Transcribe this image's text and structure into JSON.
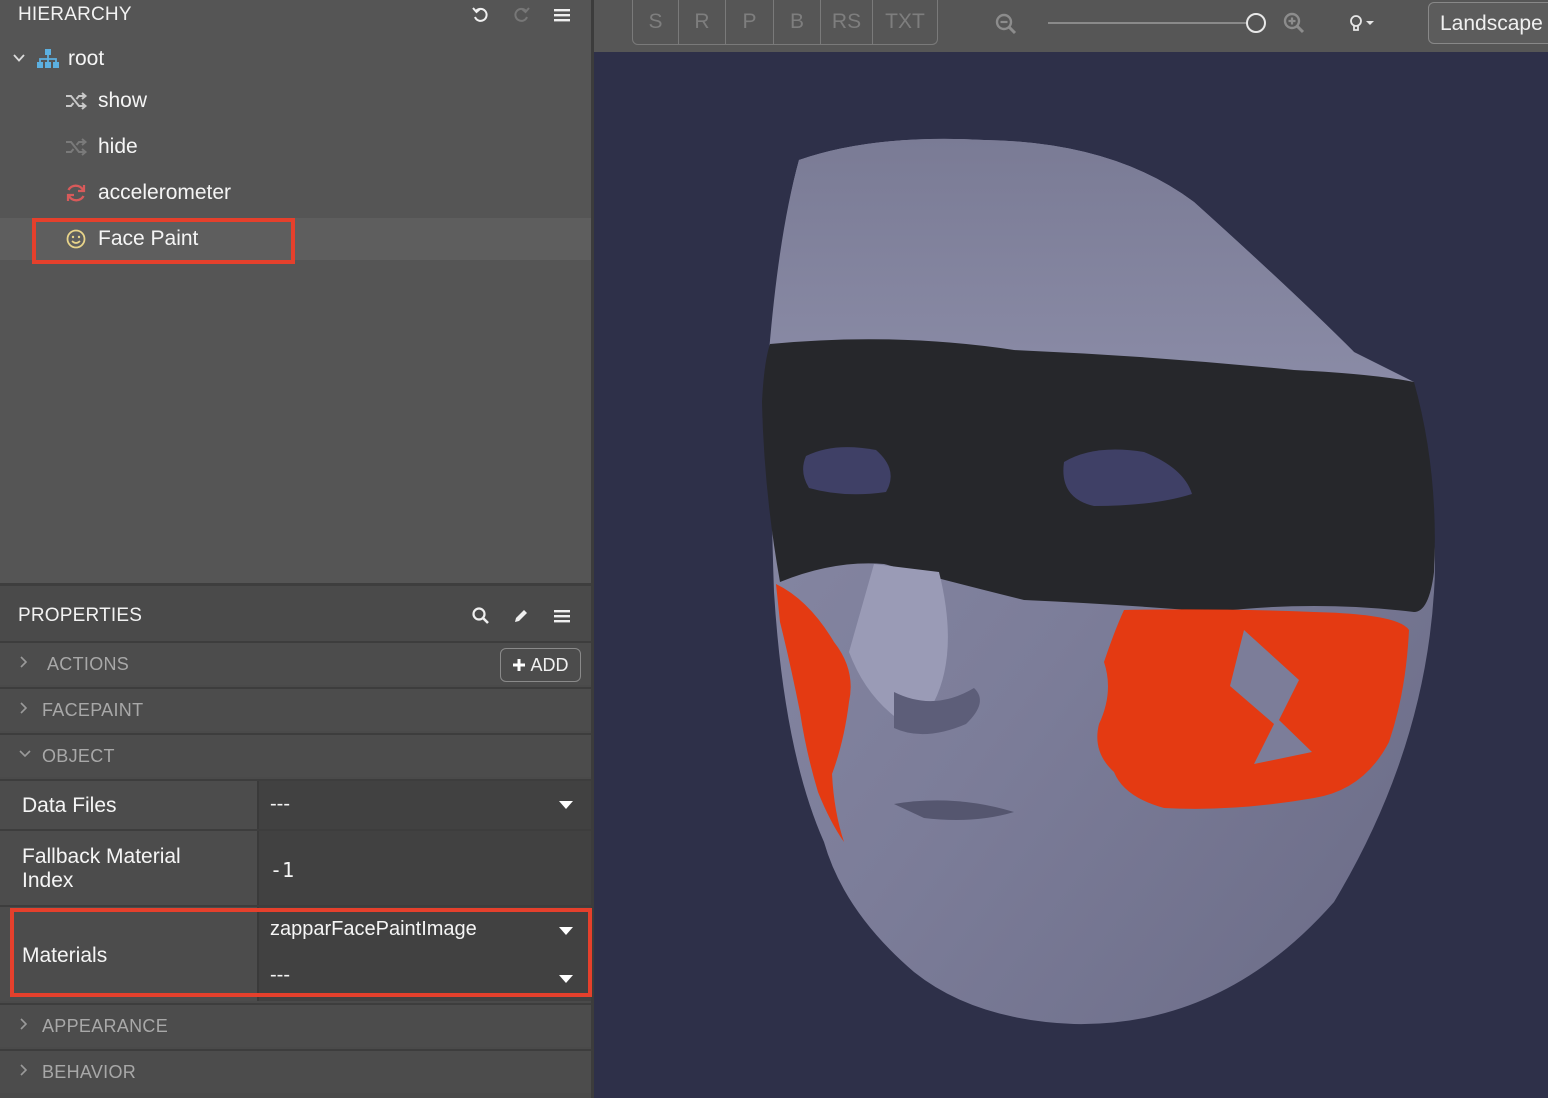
{
  "hierarchy": {
    "title": "HIERARCHY",
    "icons": [
      "undo-icon",
      "redo-icon",
      "menu-icon"
    ],
    "items": [
      {
        "label": "root",
        "icon": "hierarchy-tree-icon",
        "expanded": true
      },
      {
        "label": "show",
        "icon": "shuffle-icon"
      },
      {
        "label": "hide",
        "icon": "shuffle-icon"
      },
      {
        "label": "accelerometer",
        "icon": "refresh-icon"
      },
      {
        "label": "Face Paint",
        "icon": "smiley-face-icon",
        "selected": true
      }
    ]
  },
  "properties": {
    "title": "PROPERTIES",
    "icons": [
      "search-icon",
      "pencil-icon",
      "menu-icon"
    ],
    "sections": {
      "actions": "ACTIONS",
      "add_label": "ADD",
      "facepaint": "FACEPAINT",
      "object": "OBJECT",
      "appearance": "APPEARANCE",
      "behavior": "BEHAVIOR"
    },
    "rows": {
      "data_files": {
        "label": "Data Files",
        "value": "---"
      },
      "fallback": {
        "label_line1": "Fallback Material",
        "label_line2": "Index",
        "value": "-1"
      },
      "materials": {
        "label": "Materials",
        "value1": "zapparFacePaintImage",
        "value2": "---"
      }
    }
  },
  "viewport": {
    "view_modes": [
      "S",
      "R",
      "P",
      "B",
      "RS",
      "TXT"
    ],
    "icons": [
      "zoom-out-icon",
      "zoom-in-icon",
      "light-bulb-icon"
    ],
    "zoom_level": 1.0,
    "orientation": "Landscape"
  },
  "colors": {
    "highlight": "#e5402c",
    "panel": "#555555",
    "viewport_bg": "#2e3049",
    "face_paint_red": "#e43a12"
  }
}
